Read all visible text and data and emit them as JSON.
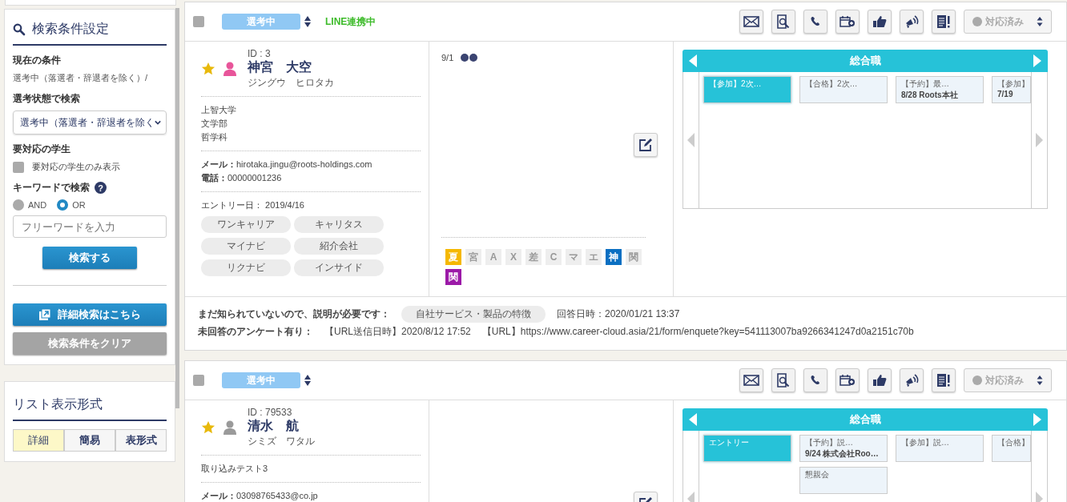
{
  "sidebar": {
    "search_panel": {
      "title": "検索条件設定",
      "current_label": "現在の条件",
      "current_value": "選考中（落選者・辞退者を除く）/",
      "status_label": "選考状態で検索",
      "status_value": "選考中（落選者・辞退者を除く",
      "attention_label": "要対応の学生",
      "attention_checkbox": {
        "label": "要対応の学生のみ表示",
        "checked": false
      },
      "keyword_label": "キーワードで検索",
      "help_mark": "?",
      "keyword_modes": [
        {
          "label": "AND",
          "selected": false
        },
        {
          "label": "OR",
          "selected": true
        }
      ],
      "keyword_placeholder": "フリーワードを入力",
      "search_button": "検索する",
      "advanced_button": "詳細検索はこちら",
      "clear_button": "検索条件をクリア"
    },
    "list_format": {
      "title": "リスト表示形式",
      "tabs": [
        {
          "label": "詳細",
          "selected": true
        },
        {
          "label": "簡易",
          "selected": false
        },
        {
          "label": "表形式",
          "selected": false
        }
      ]
    }
  },
  "candidates": [
    {
      "checked": false,
      "status": "選考中",
      "line_status": "LINE連携中",
      "response_status": "対応済み",
      "id": "ID : 3",
      "starred": true,
      "color": "#e8559a",
      "name": "神宮　大空",
      "kana": "ジングウ　ヒロタカ",
      "info_lines": [
        "上智大学",
        "文学部",
        "哲学科"
      ],
      "contact": [
        {
          "label": "メール：",
          "value": "hirotaka.jingu@roots-holdings.com"
        },
        {
          "label": "電話：",
          "value": "00000001236"
        }
      ],
      "entry_label": "エントリー日：",
      "entry_date": "2019/4/16",
      "media": [
        "ワンキャリア",
        "キャリタス",
        "マイナビ",
        "紹介会社",
        "リクナビ",
        "インサイド"
      ],
      "memo_date": "9/1",
      "flags": [
        {
          "label": "夏",
          "active": true,
          "color": "#f5b800"
        },
        {
          "label": "宮",
          "active": false
        },
        {
          "label": "A",
          "active": false
        },
        {
          "label": "X",
          "active": false
        },
        {
          "label": "差",
          "active": false
        },
        {
          "label": "C",
          "active": false
        },
        {
          "label": "マ",
          "active": false
        },
        {
          "label": "エ",
          "active": false
        },
        {
          "label": "神",
          "active": true,
          "color": "#0a6fc2"
        },
        {
          "label": "関",
          "active": false
        },
        {
          "label": "関",
          "active": true,
          "color": "#9c1aa8"
        }
      ],
      "timeline": {
        "title": "総合職",
        "columns": [
          [
            {
              "lines": [
                "【参加】2次…"
              ],
              "selected": true
            }
          ],
          [
            {
              "lines": [
                "【合格】2次…"
              ],
              "selected": false
            }
          ],
          [
            {
              "lines": [
                "【予約】最…",
                "8/28 Roots本社"
              ],
              "selected": false
            }
          ],
          [
            {
              "lines": [
                "【参加】",
                "7/19"
              ],
              "selected": false
            }
          ]
        ]
      },
      "survey": {
        "label": "まだ知られていないので、説明が必要です：",
        "answer": "自社サービス・製品の特徴",
        "answered_at": "回答日時：2020/01/21 13:37"
      },
      "pending": {
        "label": "未回答のアンケート有り：",
        "sent_at": "【URL送信日時】2020/8/12 17:52",
        "url": "【URL】https://www.career-cloud.asia/21/form/enquete?key=541113007ba9266341247d0a2151c70b"
      }
    },
    {
      "checked": false,
      "status": "選考中",
      "response_status": "対応済み",
      "id": "ID : 79533",
      "starred": true,
      "color": "#9a9a9a",
      "name": "清水　航",
      "kana": "シミズ　ワタル",
      "info_lines": [
        "取り込みテスト3"
      ],
      "contact": [
        {
          "label": "メール：",
          "value": "03098765433@co.jp"
        }
      ],
      "timeline": {
        "title": "総合職",
        "columns": [
          [
            {
              "lines": [
                "エントリー"
              ],
              "selected": true
            }
          ],
          [
            {
              "lines": [
                "【予約】説…",
                "9/24 株式会社Roo…"
              ],
              "selected": false
            },
            {
              "lines": [
                "懇親会"
              ],
              "selected": false
            }
          ],
          [
            {
              "lines": [
                "【参加】説…"
              ],
              "selected": false
            }
          ],
          [
            {
              "lines": [
                "【合格】"
              ],
              "selected": false
            }
          ]
        ]
      }
    }
  ]
}
